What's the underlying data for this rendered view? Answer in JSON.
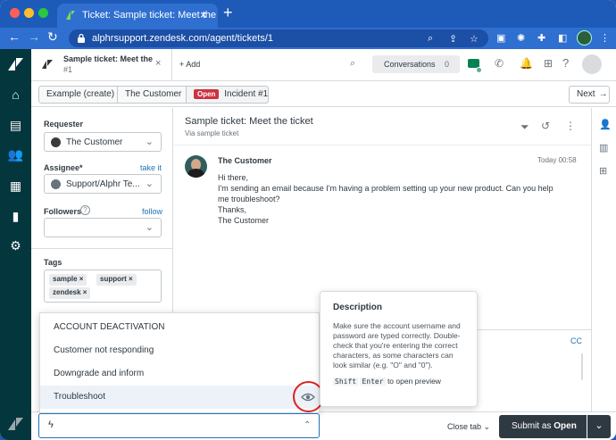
{
  "browser": {
    "tab_title": "Ticket: Sample ticket: Meet the",
    "url": "alphrsupport.zendesk.com/agent/tickets/1"
  },
  "header": {
    "ticket_tab_title": "Sample ticket: Meet the",
    "ticket_tab_sub": "#1",
    "add_label": "+ Add",
    "conversations_label": "Conversations",
    "conversations_count": "0"
  },
  "breadcrumbs": {
    "org": "Example (create)",
    "customer": "The Customer",
    "status_badge": "Open",
    "incident": "Incident #1",
    "next_label": "Next"
  },
  "left_panel": {
    "requester_label": "Requester",
    "requester_value": "The Customer",
    "assignee_label": "Assignee*",
    "take_it": "take it",
    "assignee_value": "Support/Alphr Te...",
    "followers_label": "Followers",
    "follow_link": "follow",
    "tags_label": "Tags",
    "tags": [
      "sample",
      "support",
      "zendesk"
    ]
  },
  "conversation": {
    "subject": "Sample ticket: Meet the ticket",
    "via": "Via sample ticket",
    "author": "The Customer",
    "time": "Today 00:58",
    "lines": [
      "Hi there,",
      "I'm sending an email because I'm having a problem setting up your new product. Can you help",
      "me troubleshoot?",
      "Thanks,",
      "The Customer"
    ],
    "cc_label": "CC"
  },
  "macro_menu": {
    "items": [
      "ACCOUNT DEACTIVATION",
      "Customer not responding",
      "Downgrade and inform",
      "Troubleshoot"
    ]
  },
  "description": {
    "title": "Description",
    "text": "Make sure the account username and password are typed correctly. Double-check that you're entering the correct characters, as some characters can look similar (e.g. \"O\" and \"0\").",
    "key1": "Shift",
    "key2": "Enter",
    "hint": "to open preview"
  },
  "footer": {
    "close_tab": "Close tab",
    "submit_prefix": "Submit as",
    "submit_status": "Open"
  },
  "colors": {
    "chrome": "#1e5bb8",
    "rail": "#03363d",
    "open_badge": "#cc3340",
    "submit": "#2f3941",
    "highlight_ring": "#e0201b"
  }
}
